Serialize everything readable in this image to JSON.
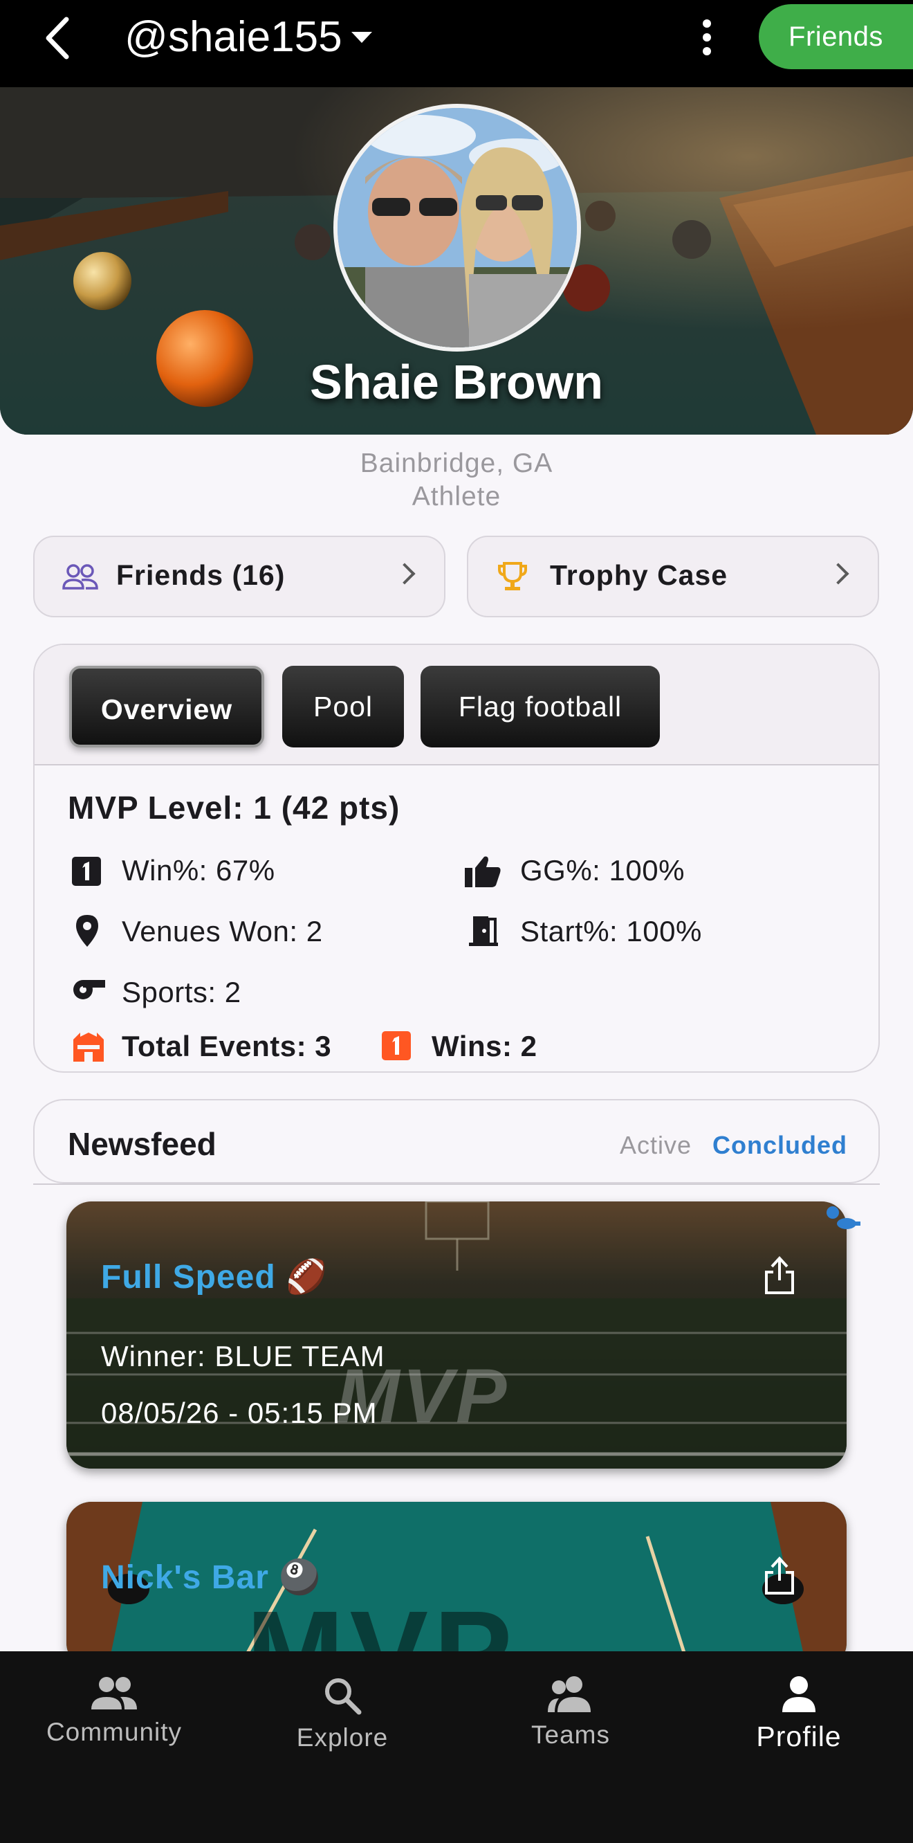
{
  "header": {
    "username": "@shaie155",
    "friends_button": "Friends"
  },
  "profile": {
    "name": "Shaie Brown",
    "location": "Bainbridge, GA",
    "role": "Athlete"
  },
  "nav_cards": {
    "friends": "Friends (16)",
    "trophy": "Trophy Case"
  },
  "tabs": [
    "Overview",
    "Pool",
    "Flag football"
  ],
  "stats": {
    "mvp_level": "MVP Level: 1 (42 pts)",
    "win_pct": "Win%: 67%",
    "gg_pct": "GG%: 100%",
    "venues_won": "Venues Won: 2",
    "start_pct": "Start%: 100%",
    "sports": "Sports: 2",
    "total_events": "Total Events: 3",
    "wins": "Wins: 2"
  },
  "newsfeed": {
    "title": "Newsfeed",
    "filter_active": "Active",
    "filter_concluded": "Concluded",
    "items": [
      {
        "title": "Full Speed 🏈",
        "winner": "Winner: BLUE TEAM",
        "datetime": "08/05/26 - 05:15 PM",
        "watermark": "MVP"
      },
      {
        "title": "Nick's Bar 🎱",
        "watermark": "MVP"
      }
    ]
  },
  "bottom_nav": [
    "Community",
    "Explore",
    "Teams",
    "Profile"
  ],
  "colors": {
    "accent_green": "#3fae49",
    "link_blue": "#2f7fd0",
    "feed_title_blue": "#3fa9e6",
    "orange": "#ff5722"
  }
}
